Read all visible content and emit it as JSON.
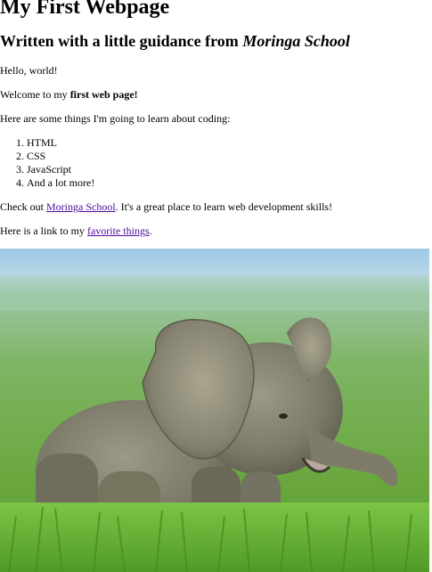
{
  "title": "My First Webpage",
  "subtitle": {
    "prefix": "Written with a little guidance from ",
    "school": "Moringa School"
  },
  "greeting": "Hello, world!",
  "welcome": {
    "prefix": "Welcome to my ",
    "bold": "first web page!"
  },
  "learn_intro": "Here are some things I'm going to learn about coding:",
  "learn_items": [
    "HTML",
    "CSS",
    "JavaScript",
    "And a lot more!"
  ],
  "checkout": {
    "prefix": "Check out ",
    "link": "Moringa School",
    "suffix": ". It's a great place to learn web development skills!"
  },
  "favorites": {
    "prefix": "Here is a link to my ",
    "link": "favorite things",
    "suffix": "."
  },
  "image": {
    "subject": "baby-elephant-photo"
  },
  "colors": {
    "link": "#4b0b9a",
    "text": "#000000",
    "background": "#ffffff"
  }
}
